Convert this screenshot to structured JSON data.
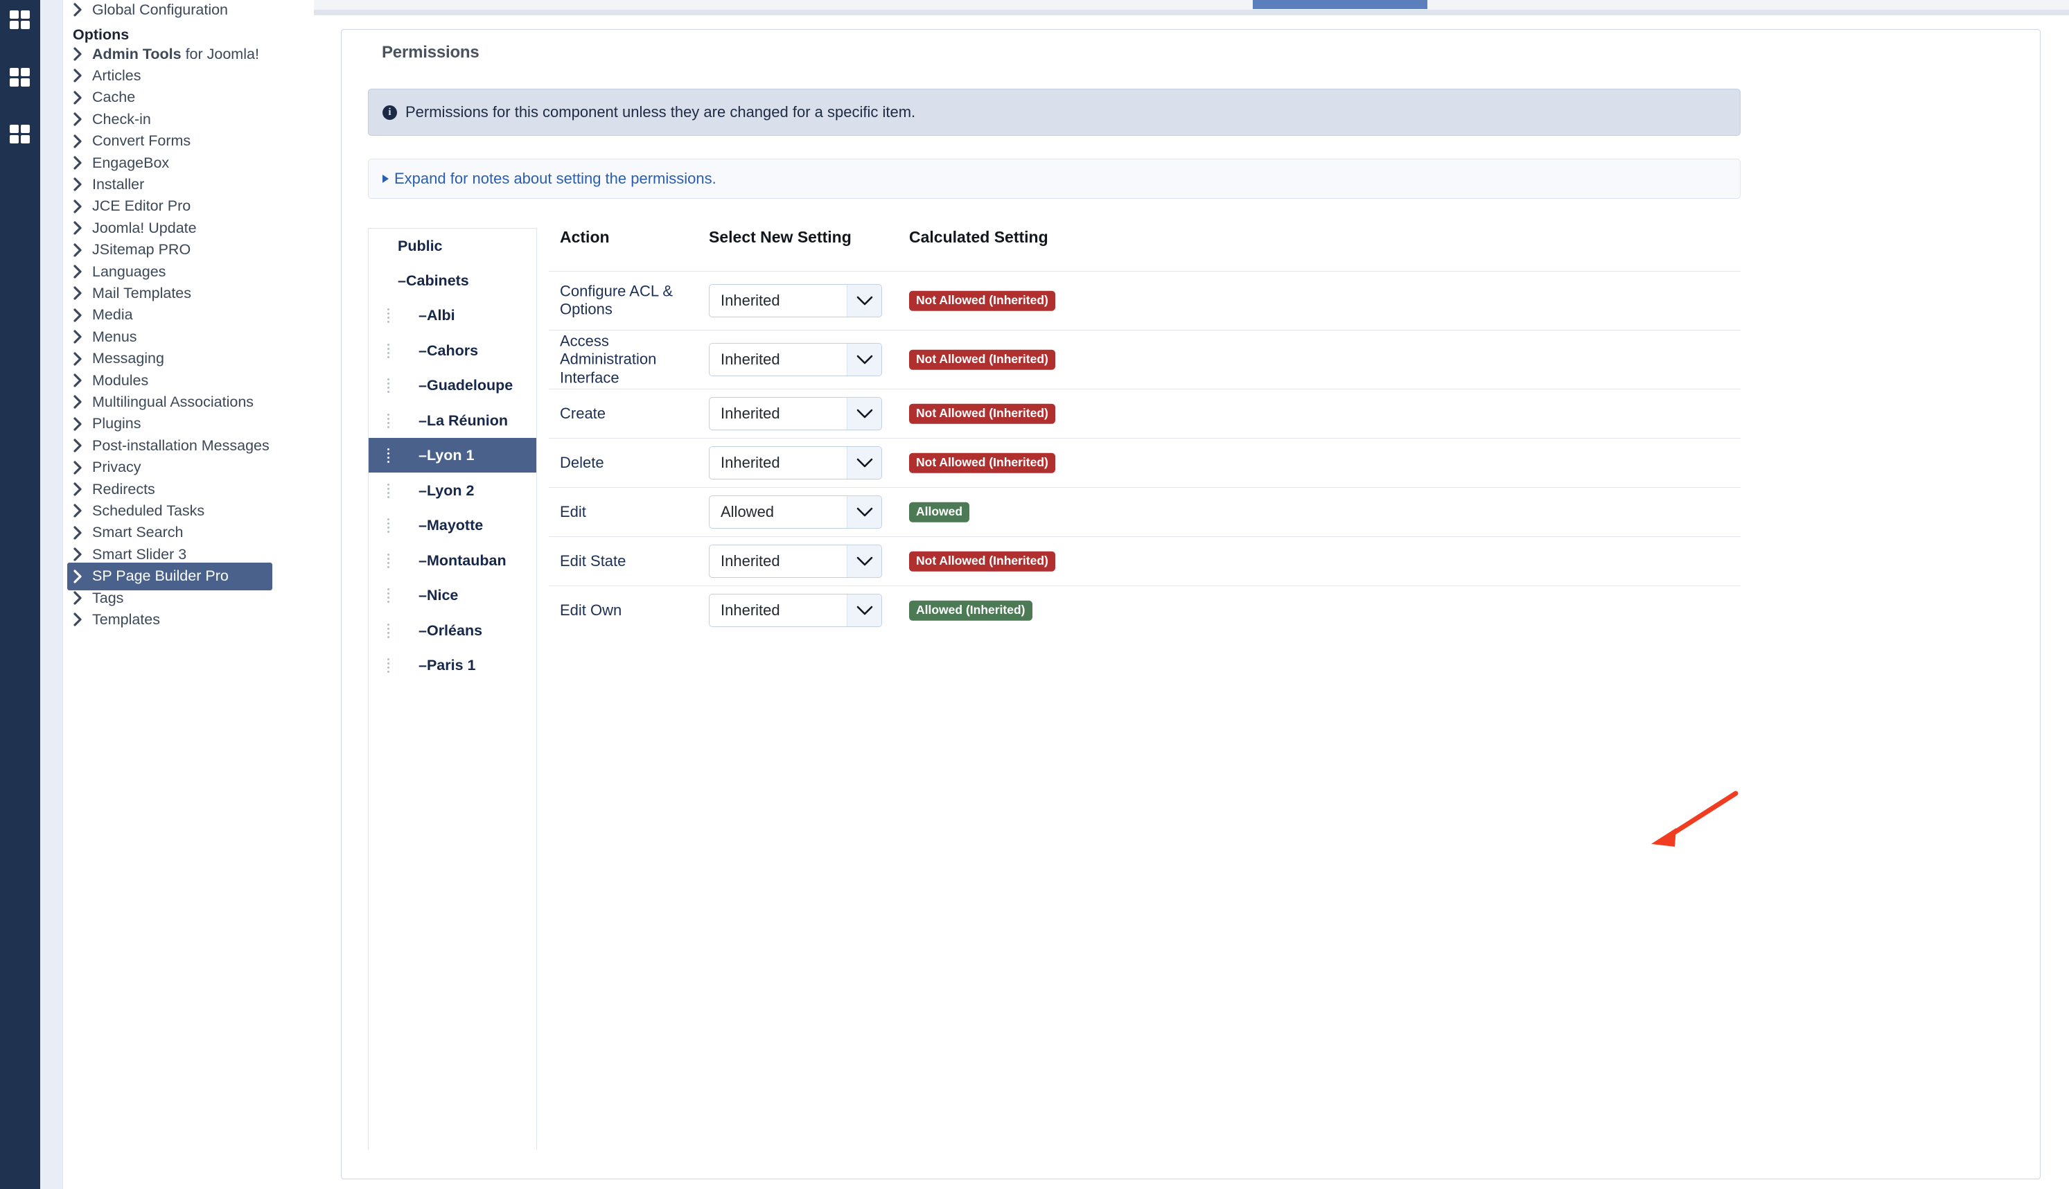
{
  "colors": {
    "rail_bg": "#1f3350",
    "active_menu": "#4a628b",
    "selected_group": "#4a628b",
    "badge_deny": "#b03030",
    "badge_allow": "#4b7a54",
    "annotation_arrow": "#f03c20",
    "tab_active": "#5b7fbd",
    "link": "#2b5eb0"
  },
  "rail": {
    "icons": [
      {
        "name": "grid-icon-1"
      },
      {
        "name": "grid-icon-2"
      },
      {
        "name": "grid-icon-3"
      }
    ]
  },
  "sidebar": {
    "top_item": {
      "label": "Global Configuration"
    },
    "heading": "Options",
    "items": [
      {
        "label": "Admin Tools",
        "label_suffix": " for Joomla!",
        "active": false
      },
      {
        "label": "Articles",
        "active": false
      },
      {
        "label": "Cache",
        "active": false
      },
      {
        "label": "Check-in",
        "active": false
      },
      {
        "label": "Convert Forms",
        "active": false
      },
      {
        "label": "EngageBox",
        "active": false
      },
      {
        "label": "Installer",
        "active": false
      },
      {
        "label": "JCE Editor Pro",
        "active": false
      },
      {
        "label": "Joomla! Update",
        "active": false
      },
      {
        "label": "JSitemap PRO",
        "active": false
      },
      {
        "label": "Languages",
        "active": false
      },
      {
        "label": "Mail Templates",
        "active": false
      },
      {
        "label": "Media",
        "active": false
      },
      {
        "label": "Menus",
        "active": false
      },
      {
        "label": "Messaging",
        "active": false
      },
      {
        "label": "Modules",
        "active": false
      },
      {
        "label": "Multilingual Associations",
        "active": false
      },
      {
        "label": "Plugins",
        "active": false
      },
      {
        "label": "Post-installation Messages",
        "active": false
      },
      {
        "label": "Privacy",
        "active": false
      },
      {
        "label": "Redirects",
        "active": false
      },
      {
        "label": "Scheduled Tasks",
        "active": false
      },
      {
        "label": "Smart Search",
        "active": false
      },
      {
        "label": "Smart Slider 3",
        "active": false
      },
      {
        "label": "SP Page Builder Pro",
        "active": true
      },
      {
        "label": "Tags",
        "active": false
      },
      {
        "label": "Templates",
        "active": false
      }
    ]
  },
  "panel": {
    "legend": "Permissions",
    "info_alert": "Permissions for this component unless they are changed for a specific item.",
    "info_icon": "info-icon",
    "notes_link": "Expand for notes about setting the permissions."
  },
  "groups": [
    {
      "label": "Public",
      "indent": 0,
      "handle": false,
      "dash": false,
      "selected": false
    },
    {
      "label": "Cabinets",
      "indent": 0,
      "handle": false,
      "dash": true,
      "selected": false
    },
    {
      "label": "Albi",
      "indent": 1,
      "handle": true,
      "dash": true,
      "selected": false
    },
    {
      "label": "Cahors",
      "indent": 1,
      "handle": true,
      "dash": true,
      "selected": false
    },
    {
      "label": "Guadeloupe",
      "indent": 1,
      "handle": true,
      "dash": true,
      "selected": false
    },
    {
      "label": "La Réunion",
      "indent": 1,
      "handle": true,
      "dash": true,
      "selected": false
    },
    {
      "label": "Lyon 1",
      "indent": 1,
      "handle": true,
      "dash": true,
      "selected": true
    },
    {
      "label": "Lyon 2",
      "indent": 1,
      "handle": true,
      "dash": true,
      "selected": false
    },
    {
      "label": "Mayotte",
      "indent": 1,
      "handle": true,
      "dash": true,
      "selected": false
    },
    {
      "label": "Montauban",
      "indent": 1,
      "handle": true,
      "dash": true,
      "selected": false
    },
    {
      "label": "Nice",
      "indent": 1,
      "handle": true,
      "dash": true,
      "selected": false
    },
    {
      "label": "Orléans",
      "indent": 1,
      "handle": true,
      "dash": true,
      "selected": false
    },
    {
      "label": "Paris 1",
      "indent": 1,
      "handle": true,
      "dash": true,
      "selected": false
    }
  ],
  "table": {
    "headers": {
      "action": "Action",
      "select": "Select New Setting",
      "calculated": "Calculated Setting"
    },
    "rows": [
      {
        "action": "Configure ACL & Options",
        "setting": "Inherited",
        "calculated": "Not Allowed (Inherited)",
        "calc_state": "deny"
      },
      {
        "action": "Access Administration Interface",
        "setting": "Inherited",
        "calculated": "Not Allowed (Inherited)",
        "calc_state": "deny"
      },
      {
        "action": "Create",
        "setting": "Inherited",
        "calculated": "Not Allowed (Inherited)",
        "calc_state": "deny"
      },
      {
        "action": "Delete",
        "setting": "Inherited",
        "calculated": "Not Allowed (Inherited)",
        "calc_state": "deny"
      },
      {
        "action": "Edit",
        "setting": "Allowed",
        "calculated": "Allowed",
        "calc_state": "allow"
      },
      {
        "action": "Edit State",
        "setting": "Inherited",
        "calculated": "Not Allowed (Inherited)",
        "calc_state": "deny"
      },
      {
        "action": "Edit Own",
        "setting": "Inherited",
        "calculated": "Allowed (Inherited)",
        "calc_state": "allow"
      }
    ]
  },
  "annotation": {
    "name": "red-arrow-annotation",
    "points_to": "Allowed"
  }
}
